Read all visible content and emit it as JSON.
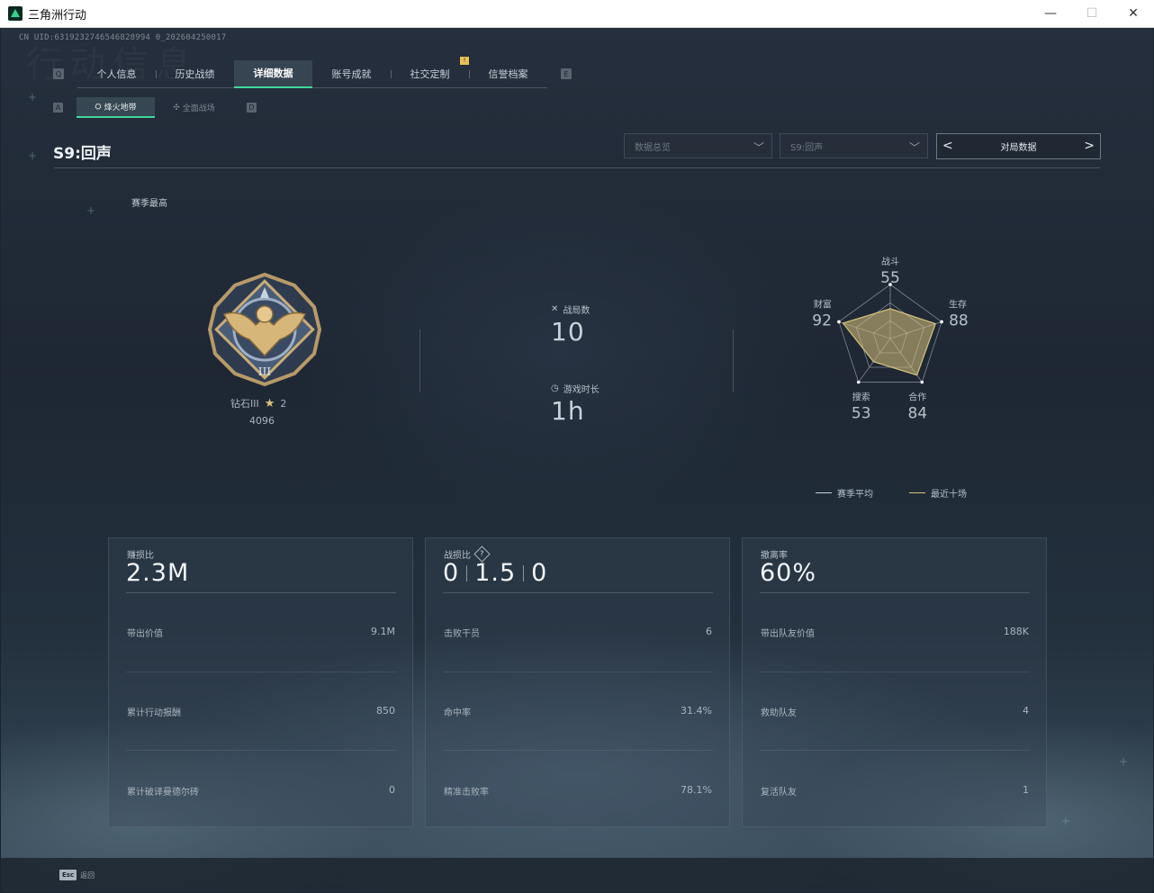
{
  "window": {
    "title": "三角洲行动",
    "minimize": "—",
    "maximize": "☐",
    "close": "✕"
  },
  "game": {
    "cn_uid": "CN UID:6319232746546828994 0_202604250017",
    "watermark": "行动信息"
  },
  "tabbar": {
    "left_key": "Q",
    "right_key": "E",
    "tabs": [
      {
        "label": "个人信息",
        "active": false
      },
      {
        "label": "历史战绩",
        "active": false
      },
      {
        "label": "详细数据",
        "active": true
      },
      {
        "label": "账号成就",
        "active": false
      },
      {
        "label": "社交定制",
        "active": false
      },
      {
        "label": "信誉档案",
        "active": false
      }
    ],
    "badge": "!"
  },
  "subtabbar": {
    "left_key": "A",
    "right_key": "D",
    "tabs": [
      {
        "label": "烽火地带",
        "icon": "flame-zone-icon",
        "active": true
      },
      {
        "label": "全面战场",
        "icon": "battlefield-icon",
        "active": false
      }
    ]
  },
  "season": {
    "title": "S9:回声"
  },
  "filters": {
    "data_scope": "数据总览",
    "season_select": "S9:回声",
    "pager_label": "对局数据"
  },
  "rank": {
    "section_label": "赛季最高",
    "name": "钻石III",
    "stars": "2",
    "score": "4096",
    "tier_roman": "III"
  },
  "match": {
    "matches_label": "战局数",
    "matches_value": "10",
    "playtime_label": "游戏时长",
    "playtime_value": "1h"
  },
  "radar": {
    "axes": [
      {
        "label": "战斗",
        "value": "55",
        "score": 55
      },
      {
        "label": "生存",
        "value": "88",
        "score": 88
      },
      {
        "label": "合作",
        "value": "84",
        "score": 84
      },
      {
        "label": "搜索",
        "value": "53",
        "score": 53
      },
      {
        "label": "财富",
        "value": "92",
        "score": 92
      }
    ],
    "max": 100,
    "legend_season_avg": "赛季平均",
    "legend_recent": "最近十场",
    "color_season_avg": "#c9d2da",
    "color_recent": "#d8c27c"
  },
  "cards": [
    {
      "head_label": "赚损比",
      "head_value": "2.3M",
      "rows": [
        {
          "label": "带出价值",
          "value": "9.1M"
        },
        {
          "label": "累计行动报酬",
          "value": "850"
        },
        {
          "label": "累计破译曼德尔砖",
          "value": "0"
        }
      ]
    },
    {
      "head_label": "战损比",
      "help": "?",
      "head_parts": [
        "0",
        "1.5",
        "0"
      ],
      "rows": [
        {
          "label": "击败干员",
          "value": "6"
        },
        {
          "label": "命中率",
          "value": "31.4%"
        },
        {
          "label": "精准击败率",
          "value": "78.1%"
        }
      ]
    },
    {
      "head_label": "撤离率",
      "head_value": "60%",
      "rows": [
        {
          "label": "带出队友价值",
          "value": "188K"
        },
        {
          "label": "救助队友",
          "value": "4"
        },
        {
          "label": "复活队友",
          "value": "1"
        }
      ]
    }
  ],
  "bottom": {
    "esc_key": "Esc",
    "esc_label": "返回"
  }
}
